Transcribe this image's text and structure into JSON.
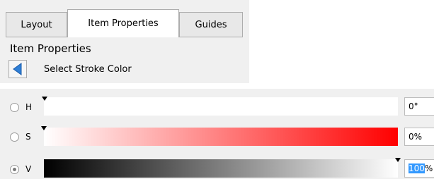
{
  "tabs": [
    {
      "label": "Layout",
      "active": false
    },
    {
      "label": "Item Properties",
      "active": true
    },
    {
      "label": "Guides",
      "active": false
    }
  ],
  "panel": {
    "title": "Item Properties",
    "breadcrumb": "Select Stroke Color",
    "back_icon": "back-arrow-icon"
  },
  "color_editor": {
    "channels": [
      {
        "letter": "H",
        "value_selected": "",
        "value_rest": "0°",
        "selected_radio": false,
        "level": 0
      },
      {
        "letter": "S",
        "value_selected": "",
        "value_rest": "0%",
        "selected_radio": false,
        "level": 0
      },
      {
        "letter": "V",
        "value_selected": "100",
        "value_rest": "%",
        "selected_radio": true,
        "level": 100
      }
    ],
    "colors": {
      "accent": "#3399ff",
      "saturation_end": "#ff0000"
    }
  }
}
